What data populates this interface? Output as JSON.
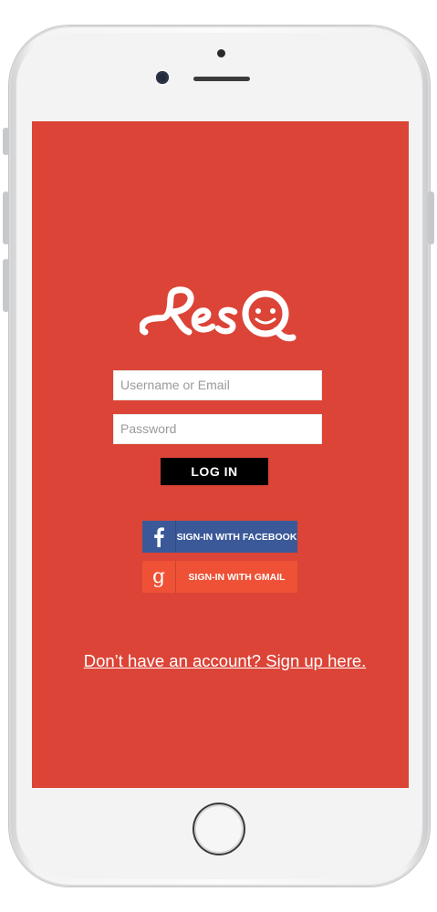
{
  "app": {
    "name": "ResQ"
  },
  "colors": {
    "screen_bg": "#db4437",
    "facebook": "#3b5998",
    "gmail": "#ee5135",
    "login_btn": "#000000"
  },
  "form": {
    "username_placeholder": "Username or Email",
    "password_placeholder": "Password",
    "login_label": "LOG IN"
  },
  "social": {
    "facebook": {
      "icon": "facebook-icon",
      "label": "SIGN-IN WITH FACEBOOK"
    },
    "gmail": {
      "icon": "google-icon",
      "label": "SIGN-IN WITH GMAIL"
    }
  },
  "signup_link": "Don’t have an account? Sign up here."
}
